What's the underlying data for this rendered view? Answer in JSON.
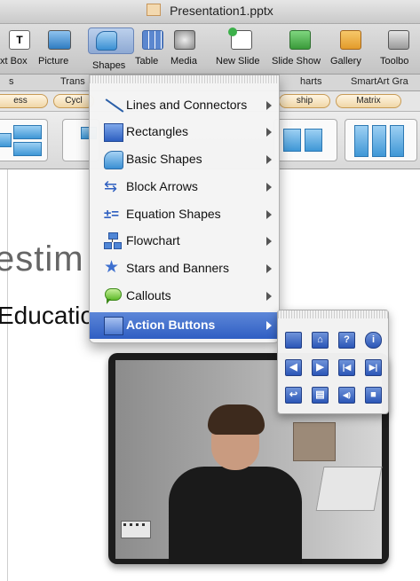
{
  "window": {
    "title": "Presentation1.pptx"
  },
  "toolbar": {
    "items": [
      {
        "label": "xt Box",
        "icon": "text-box-icon"
      },
      {
        "label": "Picture",
        "icon": "picture-icon"
      },
      {
        "label": "Shapes",
        "icon": "shapes-icon"
      },
      {
        "label": "Table",
        "icon": "table-icon"
      },
      {
        "label": "Media",
        "icon": "media-icon"
      },
      {
        "label": "New Slide",
        "icon": "new-slide-icon"
      },
      {
        "label": "Slide Show",
        "icon": "slide-show-icon"
      },
      {
        "label": "Gallery",
        "icon": "gallery-icon"
      },
      {
        "label": "Toolbo",
        "icon": "toolbox-icon"
      }
    ]
  },
  "ribbon": {
    "tabs": [
      "s",
      "Trans",
      "harts",
      "SmartArt Gra"
    ],
    "categories": [
      "ess",
      "Cycl",
      "ship",
      "Matrix"
    ]
  },
  "shapes_menu": {
    "items": [
      {
        "label": "Lines and Connectors",
        "icon": "line-icon"
      },
      {
        "label": "Rectangles",
        "icon": "rectangle-icon"
      },
      {
        "label": "Basic Shapes",
        "icon": "basic-shapes-icon"
      },
      {
        "label": "Block Arrows",
        "icon": "block-arrow-icon"
      },
      {
        "label": "Equation Shapes",
        "icon": "equation-icon"
      },
      {
        "label": "Flowchart",
        "icon": "flowchart-icon"
      },
      {
        "label": "Stars and Banners",
        "icon": "star-icon"
      },
      {
        "label": "Callouts",
        "icon": "callout-icon"
      },
      {
        "label": "Action Buttons",
        "icon": "action-button-icon",
        "selected": true
      }
    ]
  },
  "action_buttons": {
    "glyphs": [
      "",
      "⌂",
      "?",
      "i",
      "◀",
      "▶",
      "|◀",
      "▶|",
      "↩",
      "▤",
      "◀)",
      "■"
    ]
  },
  "slide": {
    "title": "estim",
    "subtitle": "Educatio"
  },
  "colors": {
    "accent": "#3a67c9",
    "highlight": "#2f5ec3",
    "smartart_blue": "#3f97d6"
  }
}
